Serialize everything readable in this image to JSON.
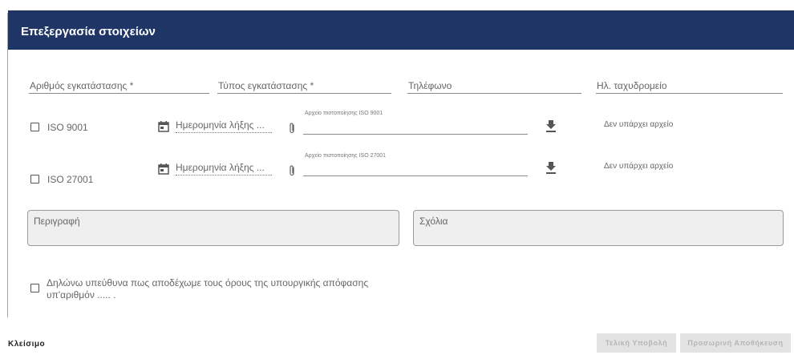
{
  "dialog": {
    "title": "Επεξεργασία στοιχείων"
  },
  "fields": {
    "installation_number": "Αριθμός εγκατάστασης *",
    "installation_type": "Τύπος εγκατάστασης *",
    "phone": "Τηλέφωνο",
    "email": "Ηλ. ταχυδρομείο"
  },
  "certificates": [
    {
      "checkbox_label": "ISO 9001",
      "date_placeholder": "Ημερομηνία λήξης ...",
      "file_caption": "Αρχείο πιστοποίησης ISO 9001",
      "file_status": "Δεν υπάρχει αρχείο"
    },
    {
      "checkbox_label": "ISO 27001",
      "date_placeholder": "Ημερομηνία λήξης ...",
      "file_caption": "Αρχείο πιστοποίησης ISO 27001",
      "file_status": "Δεν υπάρχει αρχείο"
    }
  ],
  "textareas": {
    "description_label": "Περιγραφή",
    "comments_label": "Σχόλια"
  },
  "declaration": {
    "text": "Δηλώνω υπεύθυνα πως αποδέχωμε τους όρους της υπουργικής απόφασης υπ'αριθμόν ..... ."
  },
  "footer": {
    "close_label": "Κλείσιμο",
    "submit_label": "Τελική Υποβολή",
    "save_label": "Προσωρινή Αποθήκευση"
  },
  "colors": {
    "header_bg": "#1f3566",
    "disabled_bg": "#e3e3e3",
    "disabled_text": "#b5b5b5"
  },
  "icons": {
    "date": "calendar-icon",
    "attach": "paperclip-icon",
    "download": "download-icon"
  }
}
